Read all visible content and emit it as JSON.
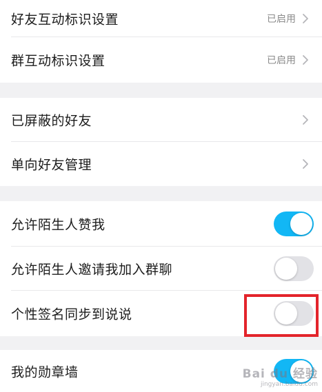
{
  "settings": {
    "items": [
      {
        "label": "好友互动标识设置",
        "status": "已启用"
      },
      {
        "label": "群互动标识设置",
        "status": "已启用"
      },
      {
        "label": "已屏蔽的好友"
      },
      {
        "label": "单向好友管理"
      },
      {
        "label": "允许陌生人赞我",
        "toggle": "on"
      },
      {
        "label": "允许陌生人邀请我加入群聊",
        "toggle": "off"
      },
      {
        "label": "个性签名同步到说说",
        "toggle": "off"
      },
      {
        "label": "我的勋章墙",
        "toggle": "on"
      }
    ]
  },
  "icons": {
    "chevron": "chevron-right-icon"
  },
  "colors": {
    "toggle_on": "#12b7f5",
    "toggle_off": "#e2e2e6",
    "highlight": "#e3242b",
    "page_background": "#f1f1f3"
  },
  "watermark": {
    "brand": "Bai du 经验",
    "url": "jingyan.baidu.com"
  }
}
